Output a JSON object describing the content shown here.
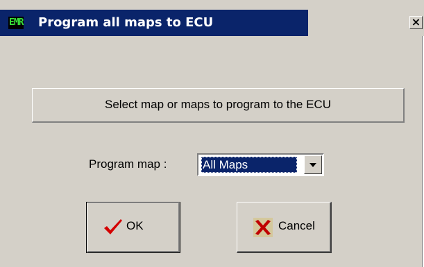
{
  "window": {
    "title": "Program all maps to ECU",
    "app_icon_text": "EMR",
    "close_symbol": "×"
  },
  "banner": {
    "text": "Select map or maps to program to the ECU"
  },
  "program_map": {
    "label": "Program map :",
    "selected": "All Maps"
  },
  "buttons": {
    "ok_label": "OK",
    "cancel_label": "Cancel"
  },
  "icons": {
    "ok": "checkmark-icon",
    "cancel": "red-x-icon",
    "dropdown": "chevron-down-icon"
  },
  "colors": {
    "titlebar": "#0a246a",
    "face": "#d4d0c8",
    "selection": "#0a246a",
    "checkmark": "#d40000",
    "cancel_x": "#c00000"
  }
}
